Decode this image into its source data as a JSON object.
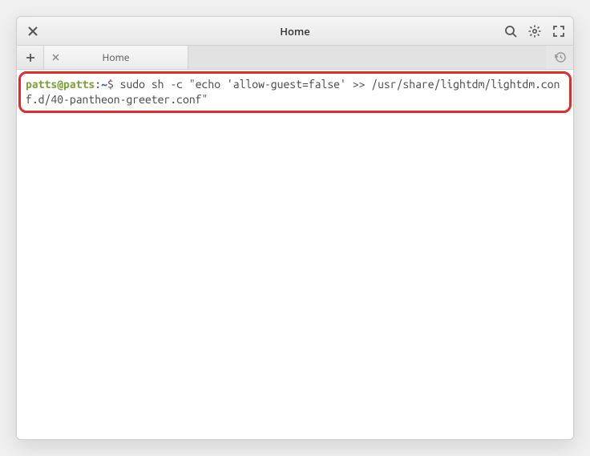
{
  "titlebar": {
    "title": "Home"
  },
  "tabs": {
    "items": [
      {
        "label": "Home"
      }
    ]
  },
  "terminal": {
    "user": "patts",
    "host": "patts",
    "path": "~",
    "command": "sudo sh -c \"echo 'allow-guest=false' >> /usr/share/lightdm/lightdm.conf.d/40-pantheon-greeter.conf\""
  }
}
